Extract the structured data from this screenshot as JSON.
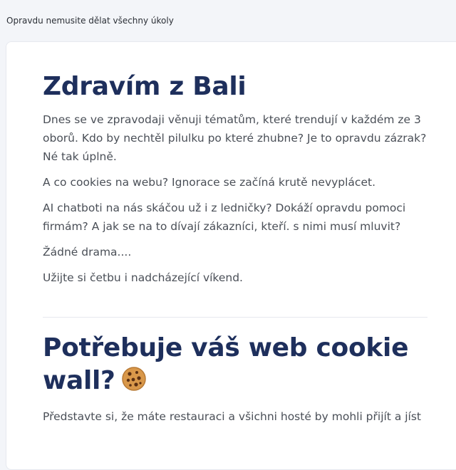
{
  "preheader": "Opravdu nemusite dělat všechny úkoly",
  "intro": {
    "title": "Zdravím z Bali",
    "paragraphs": [
      "Dnes se ve zpravodaji věnuji tématům, které trendují v každém ze 3 oborů. Kdo by nechtěl pilulku po které zhubne? Je to opravdu zázrak? Né tak úplně.",
      "A co cookies na webu? Ignorace se začíná krutě nevyplácet.",
      "AI chatboti na nás skáčou už i z ledničky? Dokáží opravdu pomoci firmám? A jak se na to dívají zákazníci, kteří. s nimi musí mluvit?",
      "Žádné drama....",
      "Užijte si četbu i nadcházející víkend."
    ]
  },
  "article": {
    "title": "Potřebuje váš web cookie wall?",
    "title_icon": "cookie-icon",
    "paragraph": "Představte si, že máte restauraci a všichni hosté by mohli přijít a jíst"
  },
  "colors": {
    "heading": "#1e2f5c",
    "body_text": "#4a4f57",
    "page_bg": "#f3f5f9",
    "card_bg": "#ffffff"
  }
}
